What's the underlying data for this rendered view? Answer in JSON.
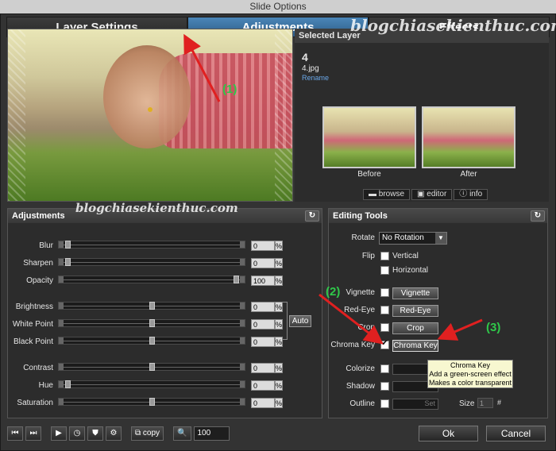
{
  "window": {
    "title": "Slide Options"
  },
  "tabs": [
    {
      "label": "Layer Settings"
    },
    {
      "label": "Adjustments"
    },
    {
      "label": "Effects"
    }
  ],
  "watermark": {
    "top": "blogchiasekienthuc.com",
    "mid": "blogchiasekienthuc.com"
  },
  "selected_layer": {
    "title": "Selected Layer",
    "number": "4",
    "file": "4.jpg",
    "rename": "Rename",
    "before": "Before",
    "after": "After",
    "browse": "browse",
    "editor": "editor",
    "info": "info"
  },
  "adjustments": {
    "title": "Adjustments",
    "rows": [
      {
        "label": "Blur",
        "value": "0",
        "fraction": 0.0
      },
      {
        "label": "Sharpen",
        "value": "0",
        "fraction": 0.0
      },
      {
        "label": "Opacity",
        "value": "100",
        "fraction": 1.0
      },
      {
        "label": "Brightness",
        "value": "0",
        "fraction": 0.5
      },
      {
        "label": "White Point",
        "value": "0",
        "fraction": 0.5
      },
      {
        "label": "Black Point",
        "value": "0",
        "fraction": 0.5
      },
      {
        "label": "Contrast",
        "value": "0",
        "fraction": 0.5
      },
      {
        "label": "Hue",
        "value": "0",
        "fraction": 0.0
      },
      {
        "label": "Saturation",
        "value": "0",
        "fraction": 0.5
      }
    ],
    "pct": "%",
    "auto": "Auto"
  },
  "editing_tools": {
    "title": "Editing Tools",
    "rotate_label": "Rotate",
    "rotate_value": "No Rotation",
    "flip_label": "Flip",
    "vertical": "Vertical",
    "horizontal": "Horizontal",
    "vignette_label": "Vignette",
    "vignette_btn": "Vignette",
    "redeye_label": "Red-Eye",
    "redeye_btn": "Red-Eye",
    "crop_label": "Crop",
    "crop_btn": "Crop",
    "chroma_label": "Chroma Key",
    "chroma_btn": "Chroma Key",
    "colorize_label": "Colorize",
    "shadow_label": "Shadow",
    "outline_label": "Outline",
    "set": "Set",
    "size_label": "Size",
    "size_value": "1",
    "hash": "#"
  },
  "tooltip": {
    "line1": "Chroma Key",
    "line2": "Add a green-screen effect",
    "line3": "Makes a color transparent"
  },
  "annotations": {
    "a1": "(1)",
    "a2": "(2)",
    "a3": "(3)"
  },
  "bottom": {
    "copy": "copy",
    "zoom": "100",
    "ok": "Ok",
    "cancel": "Cancel"
  }
}
